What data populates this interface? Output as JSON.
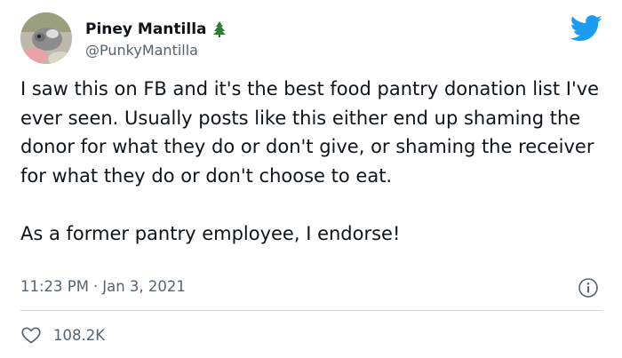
{
  "author": {
    "display_name": "Piney Mantilla",
    "handle": "@PunkyMantilla",
    "badge_icon": "evergreen-tree-icon"
  },
  "tweet": {
    "text": "I saw this on FB and it's the best food pantry donation list I've ever seen. Usually posts like this either end up shaming the donor for what they do or don't give, or shaming the receiver for what they do or don't choose to eat.\n\nAs a former pantry employee, I endorse!",
    "time": "11:23 PM",
    "separator": "·",
    "date": "Jan 3, 2021"
  },
  "actions": {
    "likes": "108.2K"
  },
  "icons": {
    "platform": "twitter-bird-icon",
    "info": "info-icon",
    "like": "heart-icon"
  },
  "colors": {
    "brand": "#1d9bf0",
    "text": "#0f1419",
    "muted": "#536471",
    "divider": "#cfd9de",
    "tree": "#2e7d32"
  }
}
